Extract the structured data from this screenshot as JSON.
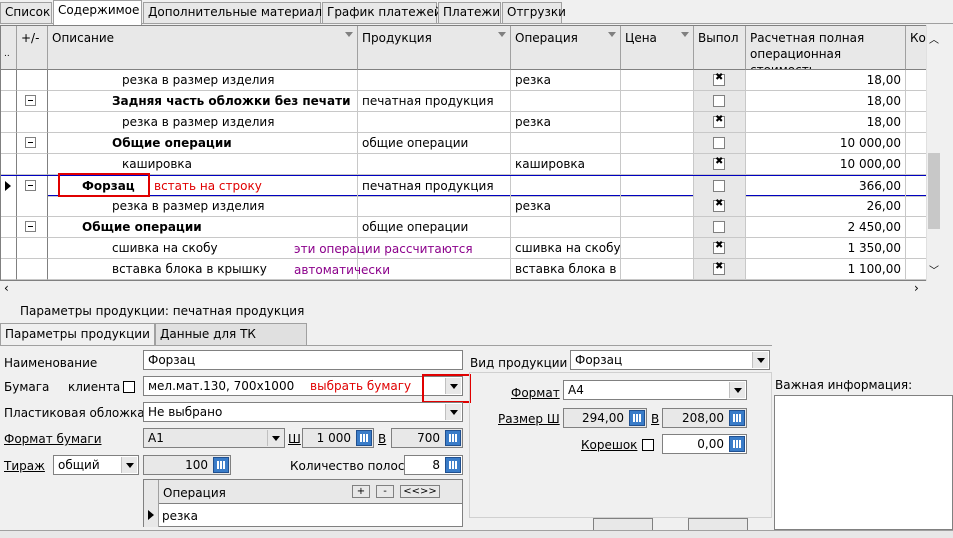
{
  "tabs": [
    "Список",
    "Содержимое",
    "Дополнительные материалы",
    "График платежей",
    "Платежи",
    "Отгрузки"
  ],
  "grid": {
    "headers": {
      "plusminus": "+/-",
      "dots": "..",
      "description": "Описание",
      "product": "Продукция",
      "operation": "Операция",
      "price": "Цена",
      "done": "Выпол",
      "cost": "Расчетная полная операционная стоимость",
      "qty": "Ко"
    },
    "rows": [
      {
        "desc": "резка в размер изделия",
        "product": "",
        "operation": "резка",
        "checked": true,
        "cost": "18,00",
        "tree": false,
        "bold": false
      },
      {
        "desc": "Задняя часть обложки без печати",
        "product": "печатная продукция",
        "operation": "",
        "checked": false,
        "cost": "18,00",
        "tree": true,
        "bold": true
      },
      {
        "desc": "резка в размер изделия",
        "product": "",
        "operation": "резка",
        "checked": true,
        "cost": "18,00",
        "tree": false,
        "bold": false
      },
      {
        "desc": "Общие операции",
        "product": "общие операции",
        "operation": "",
        "checked": false,
        "cost": "10 000,00",
        "tree": true,
        "bold": true
      },
      {
        "desc": "кашировка",
        "product": "",
        "operation": "кашировка",
        "checked": true,
        "cost": "10 000,00",
        "tree": false,
        "bold": false
      },
      {
        "desc": "Форзац",
        "product": "печатная продукция",
        "operation": "",
        "checked": false,
        "cost": "366,00",
        "tree": true,
        "bold": true
      },
      {
        "desc": "резка в размер изделия",
        "product": "",
        "operation": "резка",
        "checked": true,
        "cost": "26,00",
        "tree": false,
        "bold": false
      },
      {
        "desc": "Общие операции",
        "product": "общие операции",
        "operation": "",
        "checked": false,
        "cost": "2 450,00",
        "tree": true,
        "bold": true
      },
      {
        "desc": "сшивка на скобу",
        "product": "",
        "operation": "сшивка на скобу",
        "checked": true,
        "cost": "1 350,00",
        "tree": false,
        "bold": false
      },
      {
        "desc": "вставка блока в крышку",
        "product": "",
        "operation": "вставка блока в кр",
        "checked": true,
        "cost": "1 100,00",
        "tree": false,
        "bold": false
      }
    ],
    "annotations": {
      "row_hint": "встать на строку",
      "auto_hint_1": "эти операции рассчитаются",
      "auto_hint_2": "автоматически"
    }
  },
  "params": {
    "title": "Параметры продукции: печатная продукция",
    "tab1": "Параметры продукции",
    "tab2": "Данные для ТК",
    "name_label": "Наименование",
    "name_value": "Форзац",
    "paper_label": "Бумага",
    "client_label": "клиента",
    "paper_value": "мел.мат.130, 700x1000",
    "paper_hint": "выбрать бумагу",
    "plastic_label": "Пластиковая обложка",
    "plastic_value": "Не выбрано",
    "paper_format_label": "Формат бумаги",
    "paper_format_value": "A1",
    "w_label": "Ш",
    "w_value": "1 000",
    "h_label": "В",
    "h_value": "700",
    "tirazh_label": "Тираж",
    "tirazh_mode": "общий",
    "tirazh_value": "100",
    "stripes_label": "Количество полос",
    "stripes_value": "8",
    "op_header": "Операция",
    "op_plus": "+",
    "op_minus": "-",
    "op_nav": "<<>>",
    "op_row": "резка",
    "kind_label": "Вид продукции",
    "kind_value": "Форзац",
    "format_label": "Формат",
    "format_value": "A4",
    "size_label": "Размер Ш",
    "size_w": "294,00",
    "size_h_label": "В",
    "size_h": "208,00",
    "spine_label": "Корешок",
    "spine_value": "0,00",
    "important_label": "Важная информация:"
  }
}
